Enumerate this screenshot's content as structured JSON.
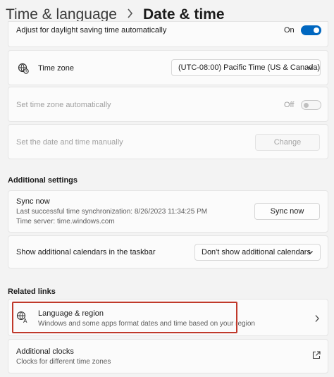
{
  "header": {
    "breadcrumb_parent": "Time & language",
    "breadcrumb_current": "Date & time"
  },
  "settings": {
    "daylight": {
      "label": "Adjust for daylight saving time automatically",
      "state_text": "On",
      "on": true
    },
    "time_zone": {
      "label": "Time zone",
      "selected": "(UTC-08:00) Pacific Time (US & Canada)"
    },
    "auto_time_zone": {
      "label": "Set time zone automatically",
      "state_text": "Off",
      "on": false
    },
    "manual_time": {
      "label": "Set the date and time manually",
      "button_label": "Change"
    }
  },
  "additional_settings": {
    "title": "Additional settings",
    "sync": {
      "label": "Sync now",
      "last_sync": "Last successful time synchronization: 8/26/2023 11:34:25 PM",
      "server": "Time server: time.windows.com",
      "button_label": "Sync now"
    },
    "calendars": {
      "label": "Show additional calendars in the taskbar",
      "selected": "Don't show additional calendars"
    }
  },
  "related_links": {
    "title": "Related links",
    "language_region": {
      "label": "Language & region",
      "description": "Windows and some apps format dates and time based on your region"
    },
    "additional_clocks": {
      "label": "Additional clocks",
      "description": "Clocks for different time zones"
    }
  },
  "colors": {
    "accent": "#0067c0",
    "highlight_border": "#c0392b"
  },
  "icons": [
    "chevron-right-icon",
    "globe-clock-icon",
    "chevron-down-icon",
    "language-icon",
    "external-link-icon"
  ]
}
